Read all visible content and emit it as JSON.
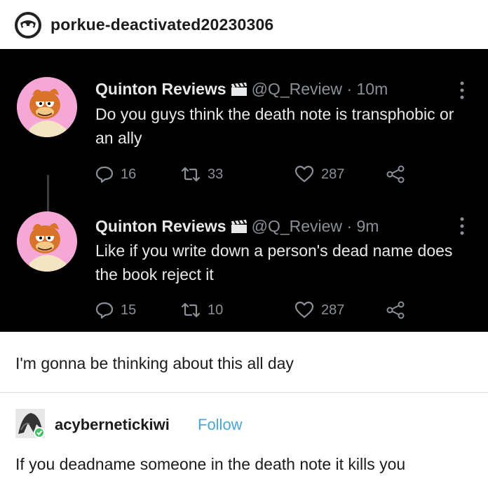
{
  "post": {
    "username": "porkue-deactivated20230306"
  },
  "tweets": [
    {
      "name": "Quinton Reviews",
      "handle": "@Q_Review",
      "time": "· 10m",
      "text": "Do you guys think the death note is transphobic or an ally",
      "replies": "16",
      "retweets": "33",
      "likes": "287"
    },
    {
      "name": "Quinton Reviews",
      "handle": "@Q_Review",
      "time": "· 9m",
      "text": "Like if you write down a person's dead name does the book reject it",
      "replies": "15",
      "retweets": "10",
      "likes": "287"
    }
  ],
  "caption": "I'm gonna be thinking about this all day",
  "reply": {
    "username": "acybernetickiwi",
    "follow_label": "Follow",
    "text": "If you deadname someone in the death note it kills you"
  },
  "colors": {
    "tweet_background": "#000000",
    "follow": "#4aa6d6",
    "muted": "#8b9096"
  },
  "icons": [
    "deactivated-avatar-icon",
    "clapperboard-icon",
    "more-options-icon",
    "reply-icon",
    "retweet-icon",
    "like-icon",
    "share-icon",
    "avatar-garfield",
    "reply-avatar"
  ]
}
